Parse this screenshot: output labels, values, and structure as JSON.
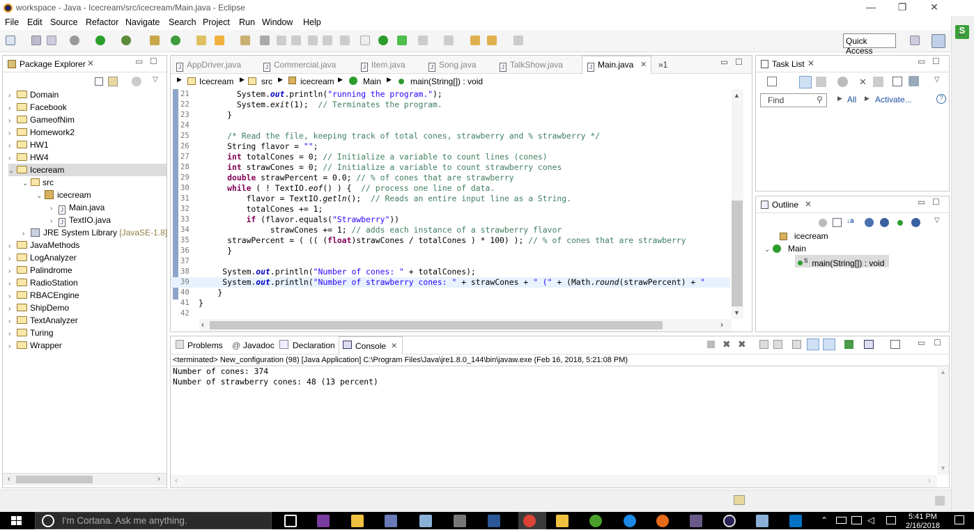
{
  "window": {
    "title": "workspace - Java - Icecream/src/icecream/Main.java - Eclipse",
    "min": "—",
    "max": "❐",
    "close": "✕"
  },
  "menu": [
    "File",
    "Edit",
    "Source",
    "Refactor",
    "Navigate",
    "Search",
    "Project",
    "Run",
    "Window",
    "Help"
  ],
  "toolbar": {
    "quick_access": "Quick Access"
  },
  "package_explorer": {
    "title": "Package Explorer",
    "items": [
      {
        "label": "Domain"
      },
      {
        "label": "Facebook"
      },
      {
        "label": "GameofNim"
      },
      {
        "label": "Homework2"
      },
      {
        "label": "HW1"
      },
      {
        "label": "HW4"
      },
      {
        "label": "Icecream"
      },
      {
        "label": "src"
      },
      {
        "label": "icecream"
      },
      {
        "label": "Main.java"
      },
      {
        "label": "TextIO.java"
      },
      {
        "label": "JRE System Library"
      },
      {
        "label": "[JavaSE-1.8]"
      },
      {
        "label": "JavaMethods"
      },
      {
        "label": "LogAnalyzer"
      },
      {
        "label": "Palindrome"
      },
      {
        "label": "RadioStation"
      },
      {
        "label": "RBACEngine"
      },
      {
        "label": "ShipDemo"
      },
      {
        "label": "TextAnalyzer"
      },
      {
        "label": "Turing"
      },
      {
        "label": "Wrapper"
      }
    ]
  },
  "editor": {
    "tabs": [
      "AppDriver.java",
      "Commercial.java",
      "Item.java",
      "Song.java",
      "TalkShow.java",
      "Main.java",
      "»1"
    ],
    "breadcrumb": [
      "Icecream",
      "src",
      "icecream",
      "Main",
      "main(String[]) : void"
    ],
    "line_numbers": [
      "21",
      "22",
      "23",
      "24",
      "25",
      "26",
      "27",
      "28",
      "29",
      "30",
      "31",
      "32",
      "33",
      "34",
      "35",
      "36",
      "37",
      "38",
      "39",
      "40",
      "41",
      "42"
    ]
  },
  "task_list": {
    "title": "Task List",
    "find_placeholder": "Find",
    "all": "All",
    "activate": "Activate...",
    "help": "?"
  },
  "outline": {
    "title": "Outline",
    "items": [
      "icecream",
      "Main",
      "main(String[]) : void"
    ],
    "static_marker": "S"
  },
  "bottom": {
    "tabs": [
      "Problems",
      "Javadoc",
      "Declaration",
      "Console"
    ],
    "status": "<terminated> New_configuration (98) [Java Application] C:\\Program Files\\Java\\jre1.8.0_144\\bin\\javaw.exe (Feb 16, 2018, 5:21:08 PM)",
    "output": [
      "Number of cones: 374",
      "Number of strawberry cones: 48 (13 percent)"
    ]
  },
  "taskbar": {
    "cortana": "I'm Cortana. Ask me anything.",
    "time": "5:41 PM",
    "date": "2/16/2018"
  },
  "colors": {
    "keyword": "#7f0055",
    "comment": "#3f7f5f",
    "string": "#2a00ff",
    "taskbar": "#000000"
  }
}
